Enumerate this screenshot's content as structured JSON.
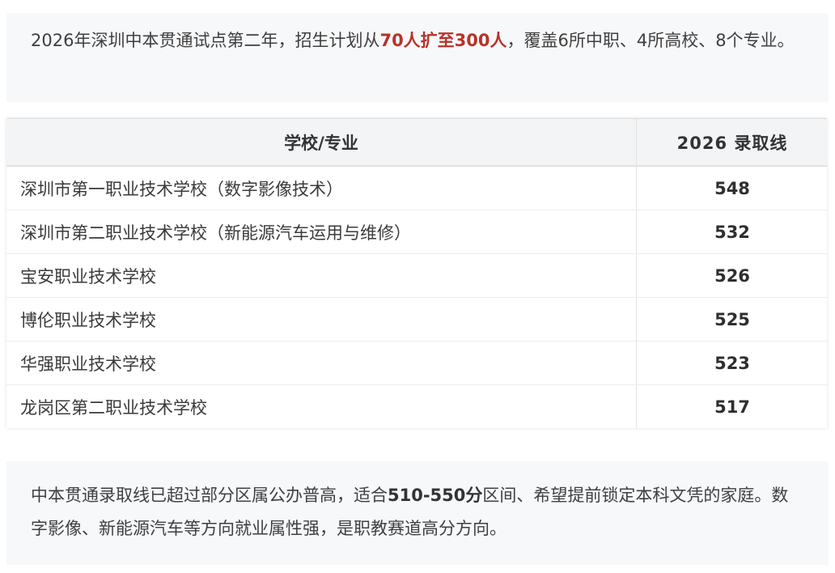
{
  "intro": {
    "text_before": "2026年深圳中本贯通试点第二年，招生计划从",
    "highlight": "70人扩至300人",
    "text_after": "，覆盖6所中职、4所高校、8个专业。"
  },
  "table": {
    "headers": {
      "school": "学校/专业",
      "score": "2026 录取线"
    },
    "rows": [
      {
        "school": "深圳市第一职业技术学校（数字影像技术）",
        "score": "548"
      },
      {
        "school": "深圳市第二职业技术学校（新能源汽车运用与维修）",
        "score": "532"
      },
      {
        "school": "宝安职业技术学校",
        "score": "526"
      },
      {
        "school": "博伦职业技术学校",
        "score": "525"
      },
      {
        "school": "华强职业技术学校",
        "score": "523"
      },
      {
        "school": "龙岗区第二职业技术学校",
        "score": "517"
      }
    ]
  },
  "summary": {
    "text_before": "中本贯通录取线已超过部分区属公办普高，适合",
    "highlight": "510-550分",
    "text_after": "区间、希望提前锁定本科文凭的家庭。数字影像、新能源汽车等方向就业属性强，是职教赛道高分方向。"
  },
  "colors": {
    "highlight_red": "#b8322a",
    "note_background": "#f7f8fa",
    "header_background": "#f3f4f6"
  }
}
